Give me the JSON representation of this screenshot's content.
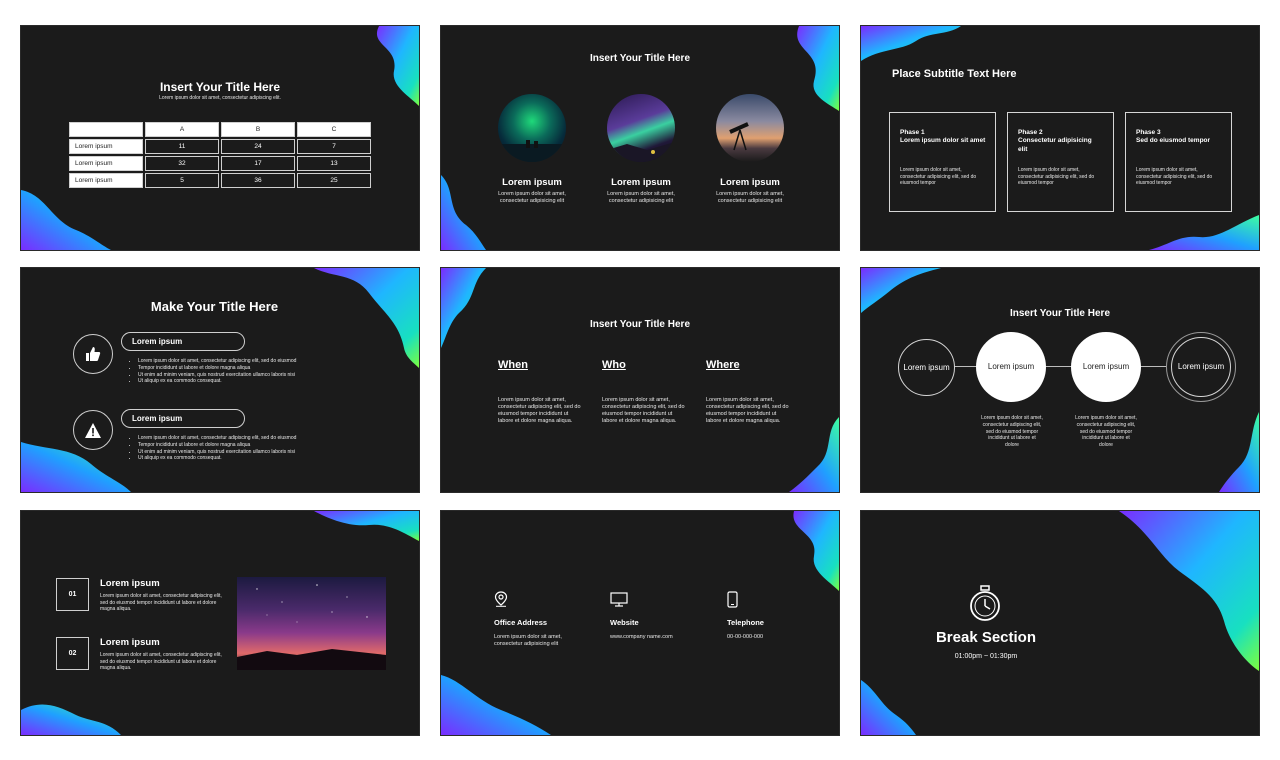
{
  "colors": {
    "slide_bg": "#1b1b1b",
    "wave_start": "#7a2cff",
    "wave_mid": "#1fb6ff",
    "wave_end": "#7dff3c"
  },
  "slide1": {
    "title": "Insert Your Title Here",
    "subtitle": "Lorem ipsum dolor sit amet, consectetur adipiscing elit.",
    "table": {
      "headers": [
        "",
        "A",
        "B",
        "C"
      ],
      "rows": [
        [
          "Lorem ipsum",
          "11",
          "24",
          "7"
        ],
        [
          "Lorem ipsum",
          "32",
          "17",
          "13"
        ],
        [
          "Lorem ipsum",
          "5",
          "36",
          "25"
        ]
      ]
    }
  },
  "slide2": {
    "title": "Insert Your Title Here",
    "cards": [
      {
        "image": "aurora-green-photo",
        "heading": "Lorem ipsum",
        "text": "Lorem ipsum dolor sit amet, consectetur adipisicing elit"
      },
      {
        "image": "aurora-purple-photo",
        "heading": "Lorem ipsum",
        "text": "Lorem ipsum dolor sit amet, consectetur adipisicing elit"
      },
      {
        "image": "telescope-sunset-photo",
        "heading": "Lorem ipsum",
        "text": "Lorem ipsum dolor sit amet, consectetur adipisicing elit"
      }
    ]
  },
  "slide3": {
    "title": "Place Subtitle Text Here",
    "phases": [
      {
        "label": "Phase 1",
        "heading": "Lorem ipsum dolor sit amet",
        "text": "Lorem ipsum dolor sit amet, consectetur adipisicing elit, sed do eiusmod tempor"
      },
      {
        "label": "Phase 2",
        "heading": "Consectetur adipisicing elit",
        "text": "Lorem ipsum dolor sit amet, consectetur adipisicing elit, sed do eiusmod tempor"
      },
      {
        "label": "Phase 3",
        "heading": "Sed do eiusmod tempor",
        "text": "Lorem ipsum dolor sit amet, consectetur adipisicing elit, sed do eiusmod tempor"
      }
    ]
  },
  "slide4": {
    "title": "Make Your Title Here",
    "items": [
      {
        "icon": "thumbs-up-icon",
        "label": "Lorem ipsum",
        "bullets": [
          "Lorem ipsum dolor sit amet, consectetur adipiscing elit, sed do eiusmod",
          "Tempor incididunt ut labore et dolore magna aliqua",
          "Ut enim ad minim veniam, quis nostrud exercitation ullamco laboris nisi",
          "Ut aliquip ex ea commodo consequat."
        ]
      },
      {
        "icon": "warning-icon",
        "label": "Lorem ipsum",
        "bullets": [
          "Lorem ipsum dolor sit amet, consectetur adipiscing elit, sed do eiusmod",
          "Tempor incididunt ut labore et dolore magna aliqua",
          "Ut enim ad minim veniam, quis nostrud exercitation ullamco laboris nisi",
          "Ut aliquip ex ea commodo consequat."
        ]
      }
    ]
  },
  "slide5": {
    "title": "Insert Your Title Here",
    "columns": [
      {
        "heading": "When",
        "text": "Lorem ipsum dolor sit amet, consectetur adipiscing elit, sed do eiusmod tempor incididunt ut labore et dolore magna aliqua."
      },
      {
        "heading": "Who",
        "text": "Lorem ipsum dolor sit amet, consectetur adipiscing elit, sed do eiusmod tempor incididunt ut labore et dolore magna aliqua."
      },
      {
        "heading": "Where",
        "text": "Lorem ipsum dolor sit amet, consectetur adipiscing elit, sed do eiusmod tempor incididunt ut labore et dolore magna aliqua."
      }
    ]
  },
  "slide6": {
    "title": "Insert Your Title Here",
    "nodes": [
      {
        "label": "Lorem ipsum"
      },
      {
        "label": "Lorem ipsum"
      },
      {
        "label": "Lorem ipsum"
      },
      {
        "label": "Lorem ipsum"
      }
    ],
    "captions": [
      "Lorem ipsum dolor sit amet, consectetur adipiscing elit, sed do eiusmod tempor incididunt ut labore et dolore",
      "Lorem ipsum dolor sit amet, consectetur adipiscing elit, sed do eiusmod tempor incididunt ut labore et dolore"
    ]
  },
  "slide7": {
    "items": [
      {
        "number": "01",
        "heading": "Lorem ipsum",
        "text": "Lorem ipsum dolor sit amet, consectetur adipiscing elit, sed do eiusmod tempor incididunt ut labore et dolore magna aliqua."
      },
      {
        "number": "02",
        "heading": "Lorem ipsum",
        "text": "Lorem ipsum dolor sit amet, consectetur adipiscing elit, sed do eiusmod tempor incididunt ut labore et dolore magna aliqua."
      }
    ],
    "image": "milky-way-photo"
  },
  "slide8": {
    "contacts": [
      {
        "icon": "location-pin-icon",
        "heading": "Office Address",
        "text": "Lorem ipsum dolor sit amet, consectetur adipisicing elit"
      },
      {
        "icon": "monitor-icon",
        "heading": "Website",
        "text": "www.company name.com"
      },
      {
        "icon": "phone-icon",
        "heading": "Telephone",
        "text": "00-00-000-000"
      }
    ]
  },
  "slide9": {
    "icon": "stopwatch-icon",
    "title": "Break Section",
    "time": "01:00pm ~ 01:30pm"
  }
}
